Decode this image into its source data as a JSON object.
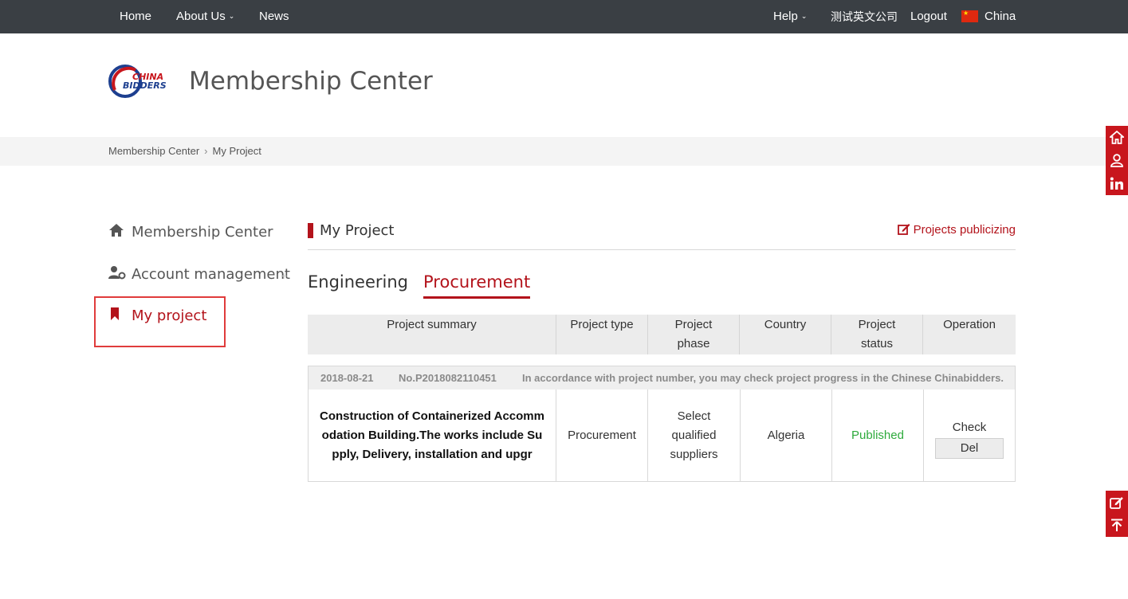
{
  "nav": {
    "home": "Home",
    "about": "About Us",
    "news": "News",
    "help": "Help",
    "company": "测试英文公司",
    "logout": "Logout",
    "region": "China"
  },
  "header": {
    "logo_text_top": "CHINA",
    "logo_text_bottom": "BIDDERS",
    "title": "Membership Center"
  },
  "breadcrumb": {
    "root": "Membership Center",
    "current": "My Project"
  },
  "sidebar": {
    "items": [
      {
        "label": "Membership Center"
      },
      {
        "label": "Account management"
      },
      {
        "label": "My project"
      }
    ]
  },
  "main": {
    "section_title": "My Project",
    "publicize_link": "Projects publicizing",
    "tabs": [
      {
        "label": "Engineering"
      },
      {
        "label": "Procurement"
      }
    ],
    "columns": [
      "Project summary",
      "Project type",
      "Project phase",
      "Country",
      "Project status",
      "Operation"
    ],
    "rows": [
      {
        "date": "2018-08-21",
        "number": "No.P2018082110451",
        "note": "In accordance with project number, you may check project progress in the Chinese Chinabidders.",
        "summary": "Construction of Containerized Accommodation Building.The works include Supply, Delivery, installation and upgr",
        "type": "Procurement",
        "phase": "Select qualified suppliers",
        "country": "Algeria",
        "status": "Published",
        "check_label": "Check",
        "del_label": "Del"
      }
    ]
  },
  "colors": {
    "accent": "#b3131b",
    "topbar": "#3a3f44",
    "status_published": "#2eaa3c"
  },
  "floating_tools": [
    "home-icon",
    "user-icon",
    "linkedin-icon",
    "edit-icon",
    "back-to-top-icon"
  ]
}
